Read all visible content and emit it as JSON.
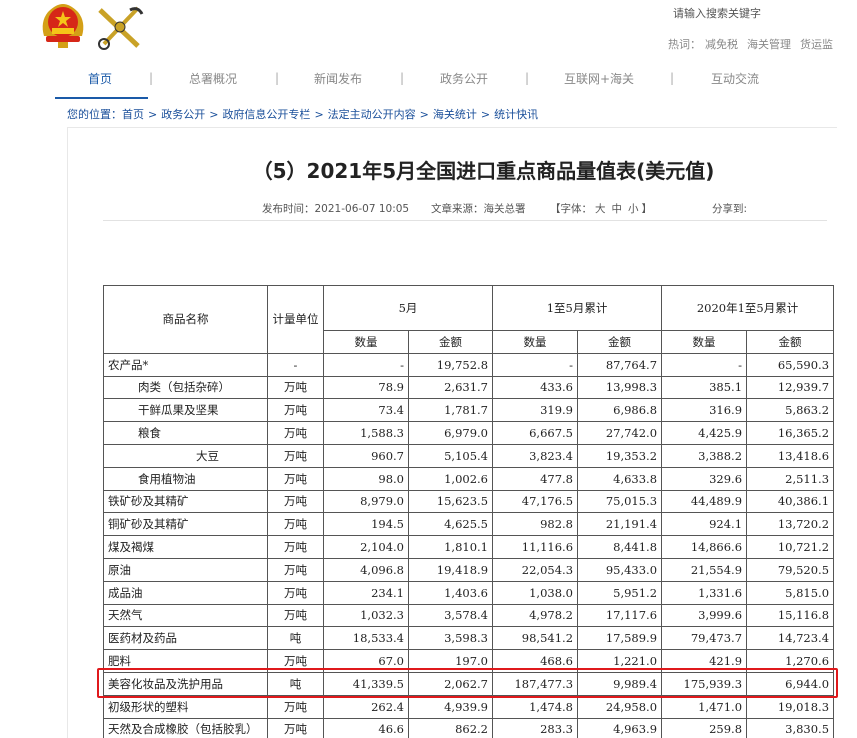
{
  "header": {
    "search_hint": "请输入搜索关键字",
    "hot_label": "热词：",
    "hot_words": [
      "减免税",
      "海关管理",
      "货运监"
    ]
  },
  "nav": {
    "items": [
      "首页",
      "总署概况",
      "新闻发布",
      "政务公开",
      "互联网+海关",
      "互动交流"
    ],
    "separator": "|"
  },
  "breadcrumb": {
    "label": "您的位置：",
    "items": [
      "首页",
      "政务公开",
      "政府信息公开专栏",
      "法定主动公开内容",
      "海关统计",
      "统计快讯"
    ],
    "separator": ">"
  },
  "article": {
    "title": "（5）2021年5月全国进口重点商品量值表(美元值)",
    "publish_time": "发布时间：2021-06-07 10:05",
    "source": "文章来源：海关总署",
    "font_label_open": "【字体：",
    "font_sizes": [
      "大",
      "中",
      "小"
    ],
    "font_label_close": "】",
    "share": "分享到:"
  },
  "table": {
    "headers": {
      "name": "商品名称",
      "unit": "计量单位",
      "groups": [
        "5月",
        "1至5月累计",
        "2020年1至5月累计"
      ],
      "qty": "数量",
      "amount": "金额"
    },
    "rows": [
      {
        "name": "农产品*",
        "indent": 0,
        "unit": "-",
        "v": [
          "-",
          "19,752.8",
          "-",
          "87,764.7",
          "-",
          "65,590.3"
        ]
      },
      {
        "name": "肉类（包括杂碎）",
        "indent": 1,
        "unit": "万吨",
        "v": [
          "78.9",
          "2,631.7",
          "433.6",
          "13,998.3",
          "385.1",
          "12,939.7"
        ]
      },
      {
        "name": "干鲜瓜果及坚果",
        "indent": 1,
        "unit": "万吨",
        "v": [
          "73.4",
          "1,781.7",
          "319.9",
          "6,986.8",
          "316.9",
          "5,863.2"
        ]
      },
      {
        "name": "粮食",
        "indent": 1,
        "unit": "万吨",
        "v": [
          "1,588.3",
          "6,979.0",
          "6,667.5",
          "27,742.0",
          "4,425.9",
          "16,365.2"
        ]
      },
      {
        "name": "大豆",
        "indent": 2,
        "unit": "万吨",
        "v": [
          "960.7",
          "5,105.4",
          "3,823.4",
          "19,353.2",
          "3,388.2",
          "13,418.6"
        ]
      },
      {
        "name": "食用植物油",
        "indent": 1,
        "unit": "万吨",
        "v": [
          "98.0",
          "1,002.6",
          "477.8",
          "4,633.8",
          "329.6",
          "2,511.3"
        ]
      },
      {
        "name": "铁矿砂及其精矿",
        "indent": 0,
        "unit": "万吨",
        "v": [
          "8,979.0",
          "15,623.5",
          "47,176.5",
          "75,015.3",
          "44,489.9",
          "40,386.1"
        ]
      },
      {
        "name": "铜矿砂及其精矿",
        "indent": 0,
        "unit": "万吨",
        "v": [
          "194.5",
          "4,625.5",
          "982.8",
          "21,191.4",
          "924.1",
          "13,720.2"
        ]
      },
      {
        "name": "煤及褐煤",
        "indent": 0,
        "unit": "万吨",
        "v": [
          "2,104.0",
          "1,810.1",
          "11,116.6",
          "8,441.8",
          "14,866.6",
          "10,721.2"
        ]
      },
      {
        "name": "原油",
        "indent": 0,
        "unit": "万吨",
        "v": [
          "4,096.8",
          "19,418.9",
          "22,054.3",
          "95,433.0",
          "21,554.9",
          "79,520.5"
        ]
      },
      {
        "name": "成品油",
        "indent": 0,
        "unit": "万吨",
        "v": [
          "234.1",
          "1,403.6",
          "1,038.0",
          "5,951.2",
          "1,331.6",
          "5,815.0"
        ]
      },
      {
        "name": "天然气",
        "indent": 0,
        "unit": "万吨",
        "v": [
          "1,032.3",
          "3,578.4",
          "4,978.2",
          "17,117.6",
          "3,999.6",
          "15,116.8"
        ]
      },
      {
        "name": "医药材及药品",
        "indent": 0,
        "unit": "吨",
        "v": [
          "18,533.4",
          "3,598.3",
          "98,541.2",
          "17,589.9",
          "79,473.7",
          "14,723.4"
        ]
      },
      {
        "name": "肥料",
        "indent": 0,
        "unit": "万吨",
        "v": [
          "67.0",
          "197.0",
          "468.6",
          "1,221.0",
          "421.9",
          "1,270.6"
        ]
      },
      {
        "name": "美容化妆品及洗护用品",
        "indent": 0,
        "unit": "吨",
        "v": [
          "41,339.5",
          "2,062.7",
          "187,477.3",
          "9,989.4",
          "175,939.3",
          "6,944.0"
        ]
      },
      {
        "name": "初级形状的塑料",
        "indent": 0,
        "unit": "万吨",
        "v": [
          "262.4",
          "4,939.9",
          "1,474.8",
          "24,958.0",
          "1,471.0",
          "19,018.3"
        ]
      },
      {
        "name": "天然及合成橡胶（包括胶乳）",
        "indent": 0,
        "unit": "万吨",
        "v": [
          "46.6",
          "862.2",
          "283.3",
          "4,963.9",
          "259.8",
          "3,830.5"
        ]
      }
    ]
  },
  "colors": {
    "nav_active": "#1a5aa8",
    "link": "#1a4f9a",
    "highlight_border": "#e0191c"
  }
}
